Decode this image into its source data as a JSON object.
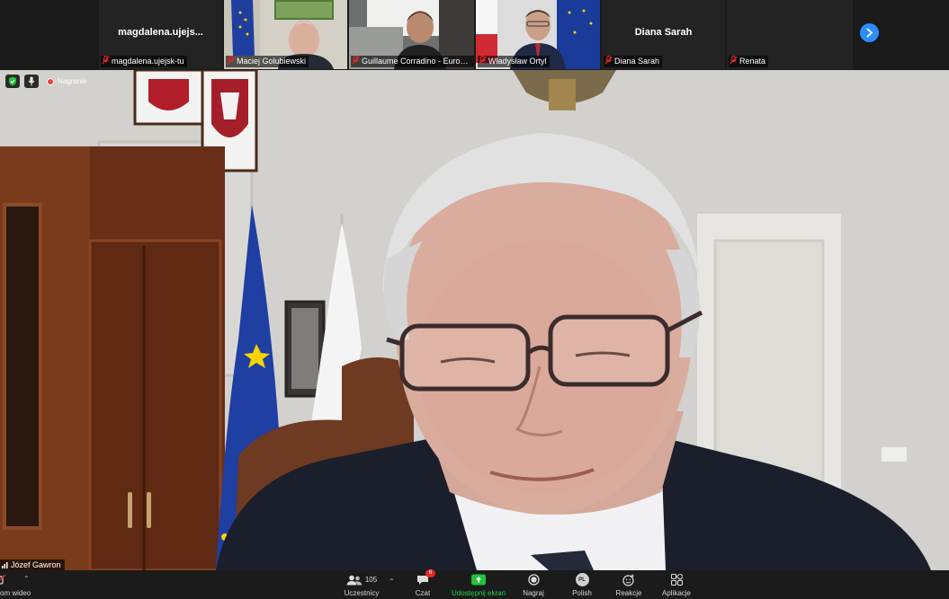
{
  "colors": {
    "accent": "#2d8cff",
    "share_green": "#23c23a",
    "share_label": "#28d148",
    "recording_red": "#e8423f",
    "mute_red": "#e02828"
  },
  "participant_strip": {
    "tiles": [
      {
        "label": "magdalena.ujejsk-tu",
        "display": "magdalena.ujejs...",
        "kind": "name-only"
      },
      {
        "label": "Maciej Golubiewski",
        "kind": "video"
      },
      {
        "label": "Guillaume Corradino - Eurom...",
        "kind": "video"
      },
      {
        "label": "Władysław Ortyl",
        "kind": "video"
      },
      {
        "label": "Diana Sarah",
        "display": "Diana Sarah",
        "kind": "name-only"
      },
      {
        "label": "Renata",
        "kind": "name-only-empty"
      }
    ],
    "next_icon": "chevron-right-icon"
  },
  "main_video": {
    "speaker": "Józef Gawron",
    "recording_label": "Nagranie",
    "badges": [
      "shield-check-icon",
      "microphone-icon"
    ]
  },
  "toolbar": {
    "video_label": "om wideo",
    "participants": {
      "label": "Uczestnicy",
      "count": "105"
    },
    "chat": {
      "label": "Czat",
      "badge": "6"
    },
    "share": {
      "label": "Udostępnij ekran"
    },
    "record": {
      "label": "Nagraj"
    },
    "language": {
      "label": "Polish",
      "avatar": "PL"
    },
    "reactions": {
      "label": "Reakcje"
    },
    "apps": {
      "label": "Aplikacje"
    }
  }
}
